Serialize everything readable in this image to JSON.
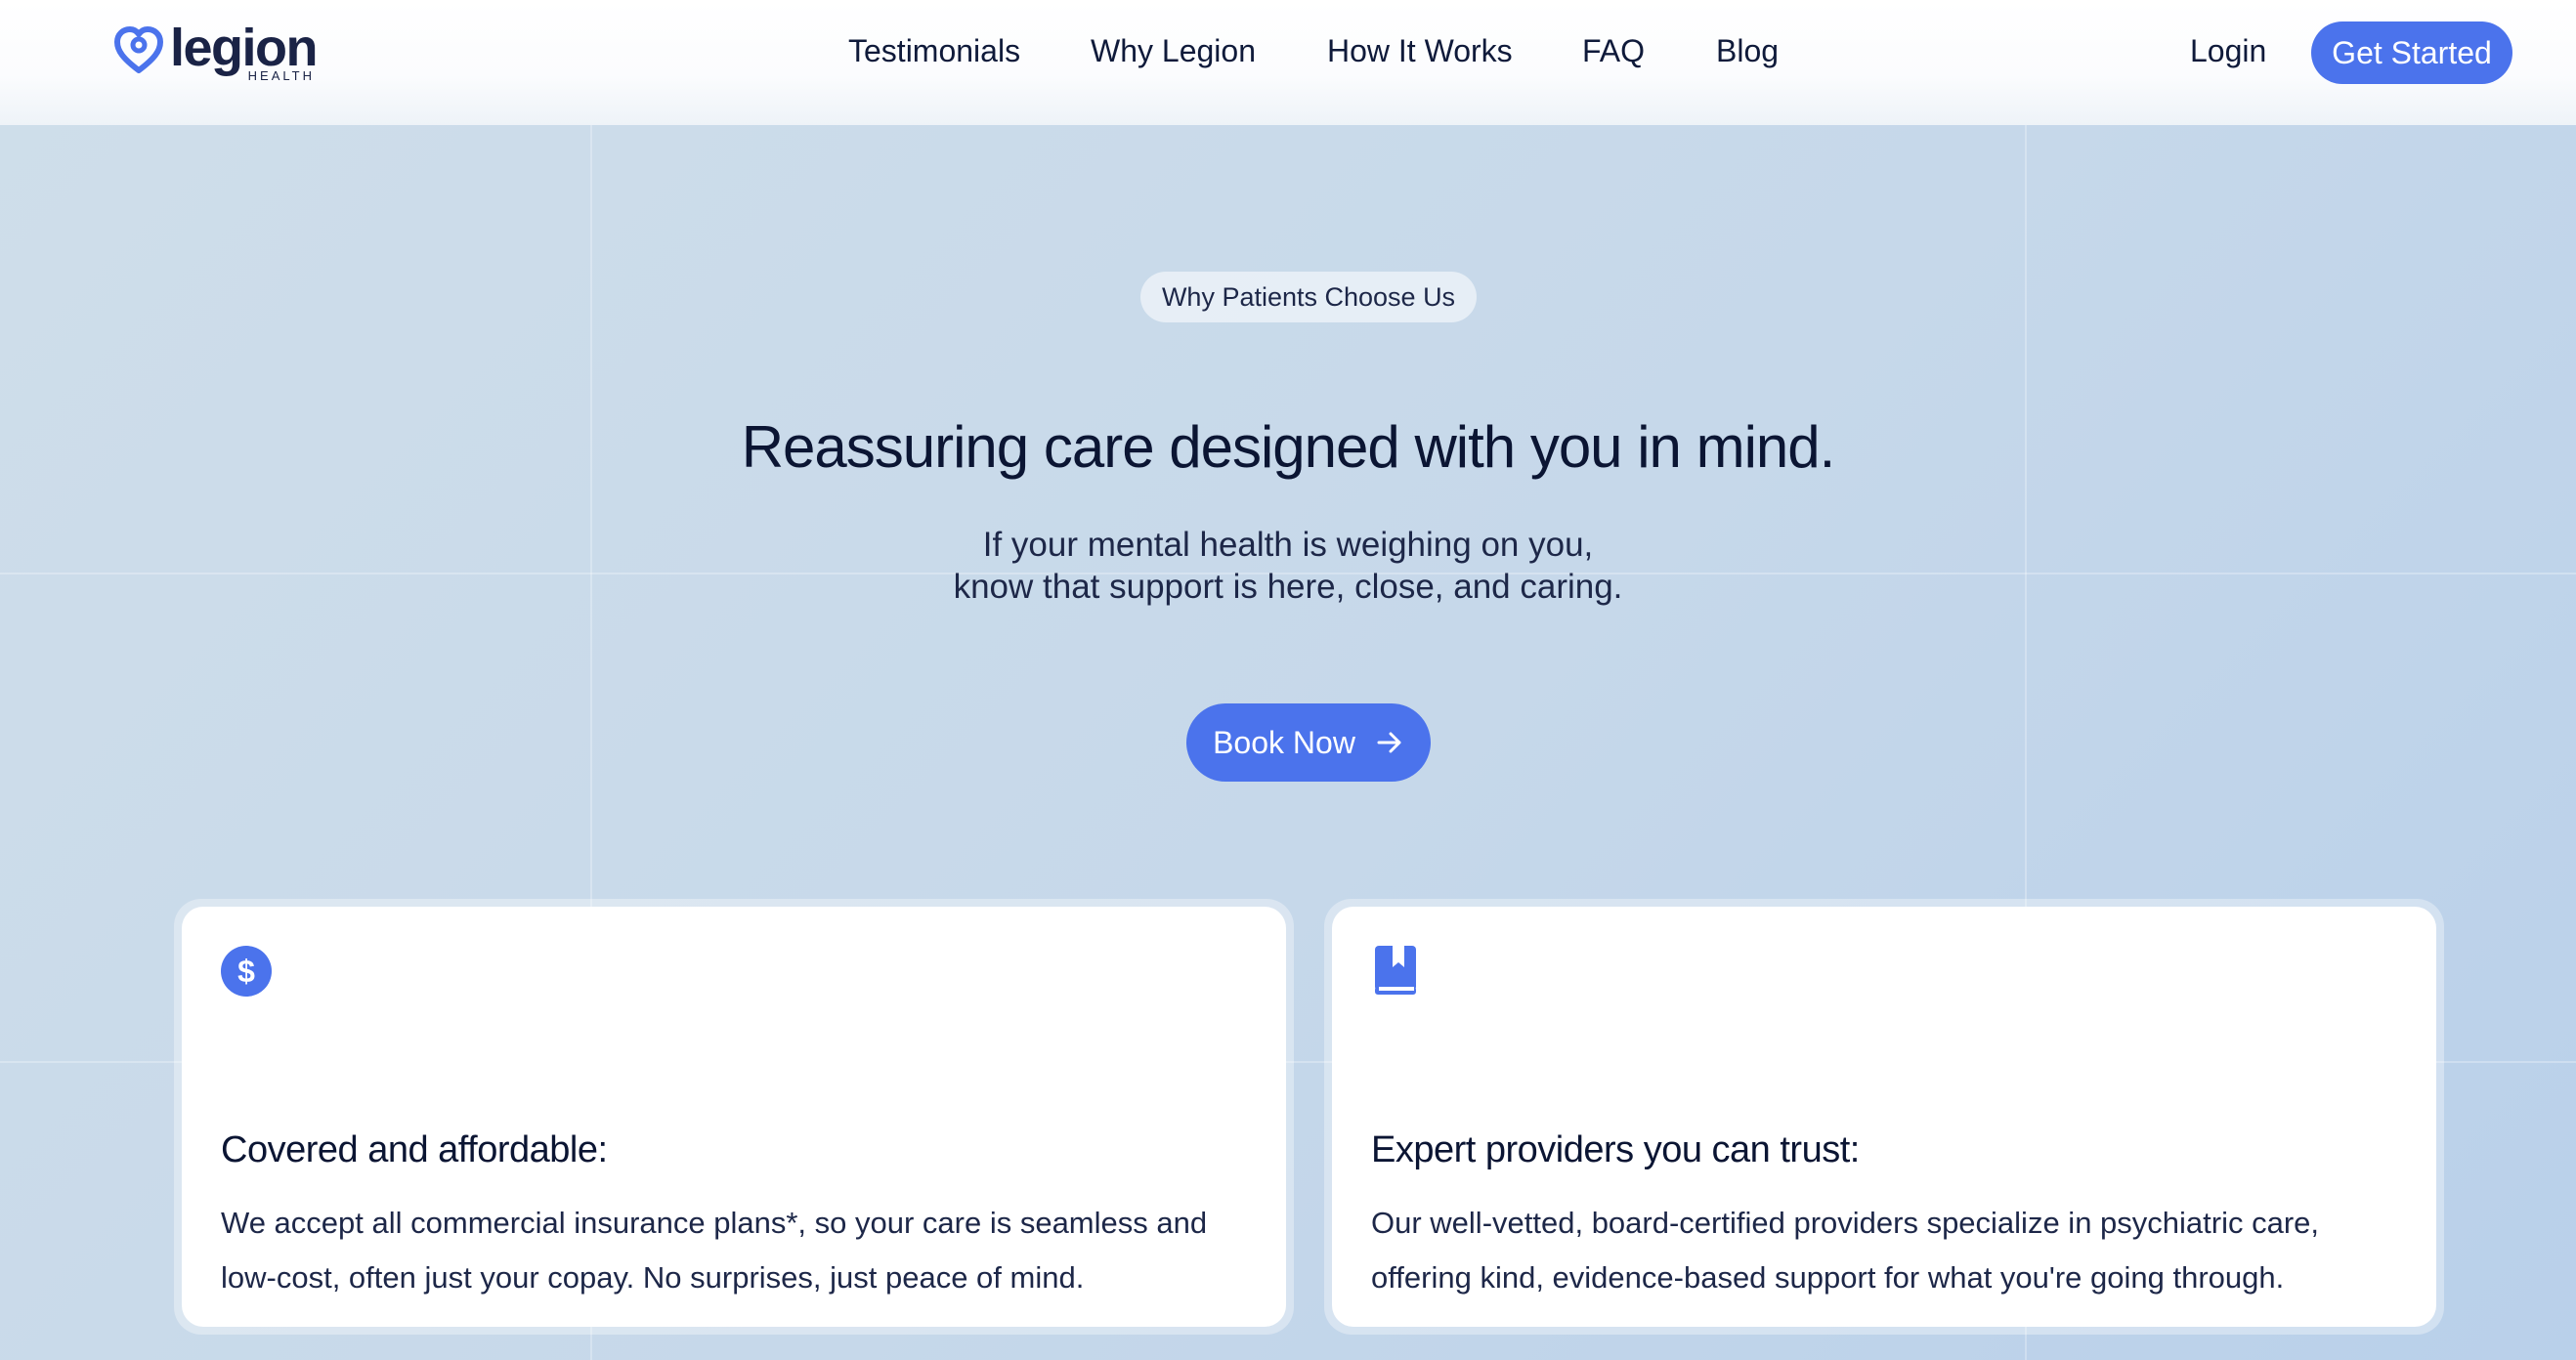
{
  "header": {
    "logo": {
      "word": "legion",
      "sub": "HEALTH"
    },
    "nav": [
      {
        "label": "Testimonials"
      },
      {
        "label": "Why Legion"
      },
      {
        "label": "How It Works"
      },
      {
        "label": "FAQ"
      },
      {
        "label": "Blog"
      }
    ],
    "login_label": "Login",
    "cta_label": "Get Started"
  },
  "hero": {
    "badge": "Why Patients Choose Us",
    "title": "Reassuring care designed with you in mind.",
    "subtitle_lines": [
      "If your mental health is weighing on you,",
      "know that support is here, close, and caring."
    ],
    "button_label": "Book Now",
    "button_icon": "arrow-right-icon"
  },
  "cards": [
    {
      "icon": "dollar-circle-icon",
      "title": "Covered and affordable:",
      "text_lines": [
        "We accept all commercial insurance plans*, so your care is seamless and",
        "low-cost, often just your copay. No surprises, just peace of mind."
      ]
    },
    {
      "icon": "bookmark-book-icon",
      "title": "Expert providers you can trust:",
      "text_lines": [
        "Our well-vetted, board-certified providers specialize in psychiatric care,",
        "offering kind, evidence-based support for what you're going through."
      ]
    }
  ],
  "colors": {
    "accent": "#4b73ec",
    "text_dark": "#0b1533",
    "background": "#c6d8ea"
  }
}
